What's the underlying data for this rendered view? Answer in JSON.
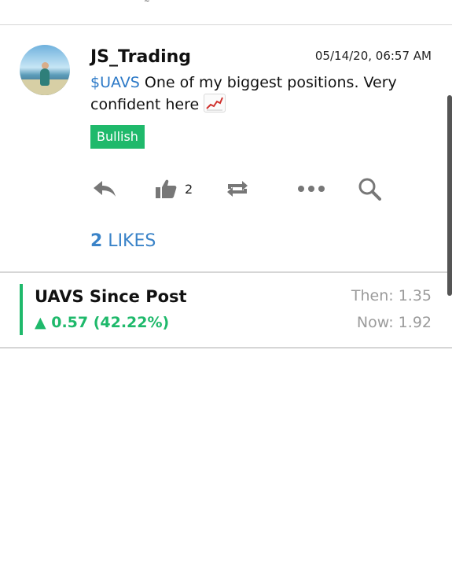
{
  "post": {
    "username": "JS_Trading",
    "timestamp": "05/14/20, 06:57 AM",
    "ticker": "$UAVS",
    "text": " One of my biggest positions. Very confident here ",
    "sentiment": "Bullish",
    "like_count": "2",
    "likes_count_bold": "2",
    "likes_label": " LIKES",
    "icons": [
      "reply-icon",
      "thumbs-up-icon",
      "repost-icon",
      "more-icon",
      "search-icon",
      "chart-increasing-emoji"
    ]
  },
  "performance": {
    "title": "UAVS Since Post",
    "change": "▲ 0.57 (42.22%)",
    "then": "Then: 1.35",
    "now": "Now: 1.92"
  },
  "colors": {
    "accent_green": "#1fb96b",
    "link_blue": "#3a83c8",
    "muted": "#9b9b9b"
  }
}
